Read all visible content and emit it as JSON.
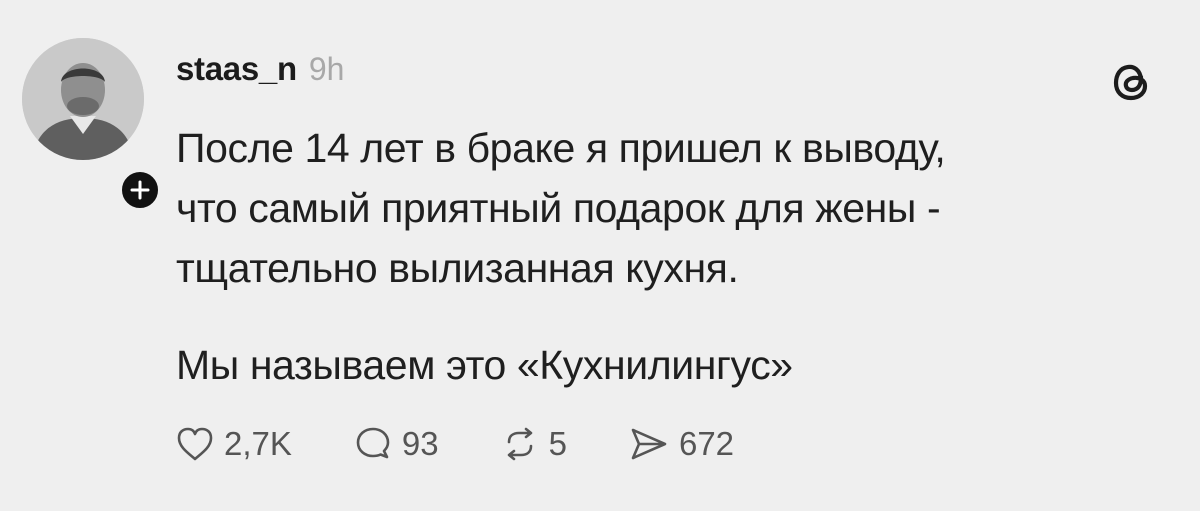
{
  "post": {
    "username": "staas_n",
    "time": "9h",
    "text_lines": [
      "После 14 лет в браке я пришел к выводу,",
      "что самый приятный подарок для жены -",
      "тщательно вылизанная кухня."
    ],
    "text_2": "Мы называем это «Кухнилингус»",
    "app_icon": "threads-icon",
    "stats": {
      "likes": "2,7K",
      "replies": "93",
      "reposts": "5",
      "shares": "672"
    }
  },
  "colors": {
    "background": "#efefef",
    "text": "#1c1c1c",
    "muted": "#a8a8a8",
    "icon": "#555555"
  }
}
